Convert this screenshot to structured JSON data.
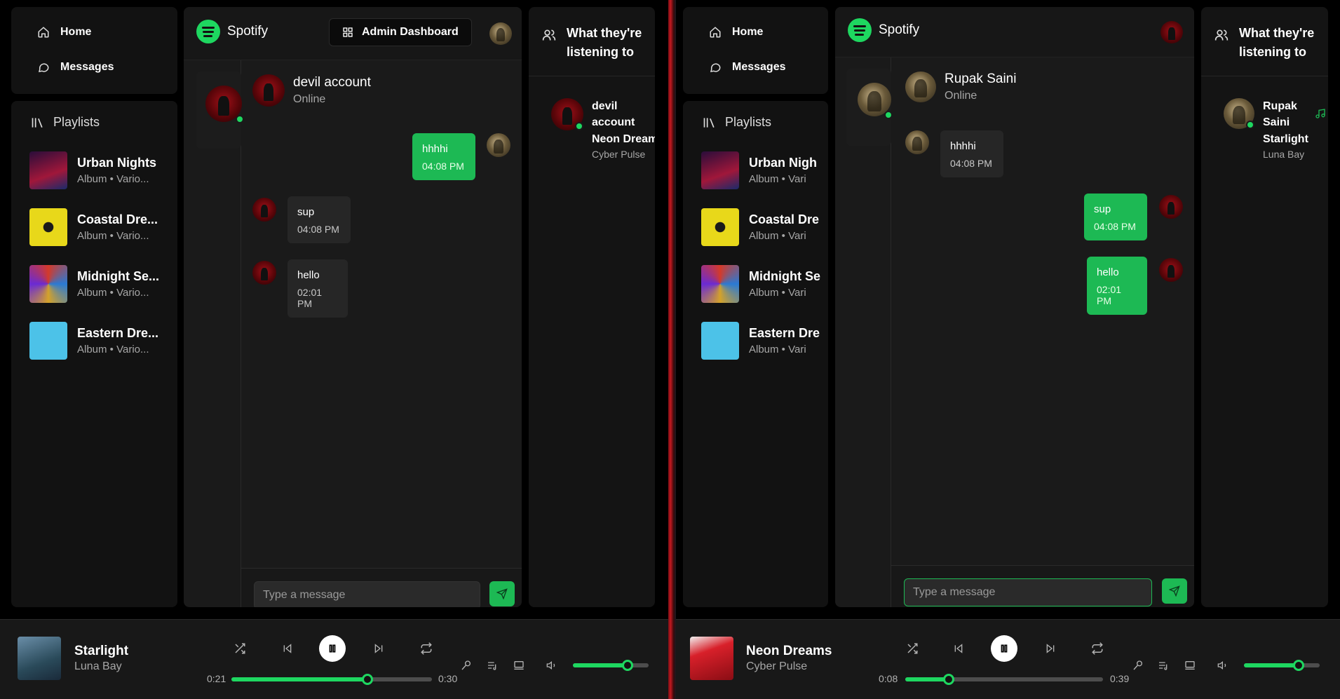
{
  "left": {
    "nav": {
      "home": "Home",
      "messages": "Messages"
    },
    "playlists_label": "Playlists",
    "playlists": [
      {
        "title": "Urban Nights",
        "sub": "Album • Vario..."
      },
      {
        "title": "Coastal Dre...",
        "sub": "Album • Vario..."
      },
      {
        "title": "Midnight Se...",
        "sub": "Album • Vario..."
      },
      {
        "title": "Eastern Dre...",
        "sub": "Album • Vario..."
      }
    ],
    "brand": "Spotify",
    "admin_label": "Admin Dashboard",
    "chat": {
      "name": "devil account",
      "status": "Online",
      "messages": [
        {
          "text": "hhhhi",
          "time": "04:08 PM",
          "from": "me"
        },
        {
          "text": "sup",
          "time": "04:08 PM",
          "from": "them"
        },
        {
          "text": "hello",
          "time": "02:01 PM",
          "from": "them"
        }
      ],
      "input_placeholder": "Type a message"
    },
    "listening_title": "What they're listening to",
    "friend": {
      "name": "devil account",
      "song": "Neon Dream",
      "artist": "Cyber Pulse"
    },
    "player": {
      "title": "Starlight",
      "artist": "Luna Bay",
      "elapsed": "0:21",
      "total": "0:30",
      "progress": 0.68,
      "volume": 0.72
    }
  },
  "right": {
    "nav": {
      "home": "Home",
      "messages": "Messages"
    },
    "playlists_label": "Playlists",
    "playlists": [
      {
        "title": "Urban Nigh",
        "sub": "Album • Vari"
      },
      {
        "title": "Coastal Dre",
        "sub": "Album • Vari"
      },
      {
        "title": "Midnight Se",
        "sub": "Album • Vari"
      },
      {
        "title": "Eastern Dre",
        "sub": "Album • Vari"
      }
    ],
    "brand": "Spotify",
    "chat": {
      "name": "Rupak Saini",
      "status": "Online",
      "messages": [
        {
          "text": "hhhhi",
          "time": "04:08 PM",
          "from": "them"
        },
        {
          "text": "sup",
          "time": "04:08 PM",
          "from": "me"
        },
        {
          "text": "hello",
          "time": "02:01 PM",
          "from": "me"
        }
      ],
      "input_placeholder": "Type a message"
    },
    "listening_title": "What they're listening to",
    "friend": {
      "name": "Rupak Saini",
      "song": "Starlight",
      "artist": "Luna Bay"
    },
    "player": {
      "title": "Neon Dreams",
      "artist": "Cyber Pulse",
      "elapsed": "0:08",
      "total": "0:39",
      "progress": 0.22,
      "volume": 0.72
    }
  },
  "colors": {
    "accent": "#1db954",
    "panel": "#121212",
    "background": "#000000"
  },
  "icons": [
    "home-icon",
    "message-icon",
    "library-icon",
    "spotify-logo",
    "grid-icon",
    "users-icon",
    "music-note-icon",
    "shuffle-icon",
    "previous-icon",
    "pause-icon",
    "next-icon",
    "repeat-icon",
    "mic-icon",
    "queue-icon",
    "device-icon",
    "volume-icon",
    "send-icon"
  ]
}
